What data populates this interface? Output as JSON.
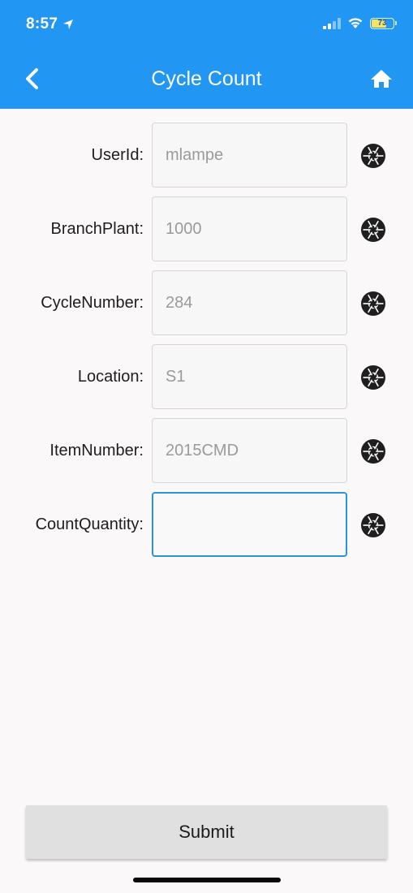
{
  "status_bar": {
    "time": "8:57",
    "battery": "73",
    "battery_level_percent": 73,
    "location_icon": "location-arrow-icon",
    "signal_icon": "cellular-signal-icon",
    "wifi_icon": "wifi-icon"
  },
  "header": {
    "title": "Cycle Count",
    "back_icon": "chevron-left-icon",
    "home_icon": "home-icon"
  },
  "form": {
    "fields": [
      {
        "label": "UserId:",
        "value": "mlampe",
        "scan_icon": "camera-shutter-icon"
      },
      {
        "label": "BranchPlant:",
        "value": "1000",
        "scan_icon": "camera-shutter-icon"
      },
      {
        "label": "CycleNumber:",
        "value": "284",
        "scan_icon": "camera-shutter-icon"
      },
      {
        "label": "Location:",
        "value": "S1",
        "scan_icon": "camera-shutter-icon"
      },
      {
        "label": "ItemNumber:",
        "value": "2015CMD",
        "scan_icon": "camera-shutter-icon"
      },
      {
        "label": "CountQuantity:",
        "value": "",
        "scan_icon": "camera-shutter-icon"
      }
    ]
  },
  "footer": {
    "submit_label": "Submit"
  },
  "colors": {
    "header": "#2196f3",
    "background": "#faf8f9",
    "active_border": "#2b93d7",
    "button": "#e0e0e0"
  }
}
